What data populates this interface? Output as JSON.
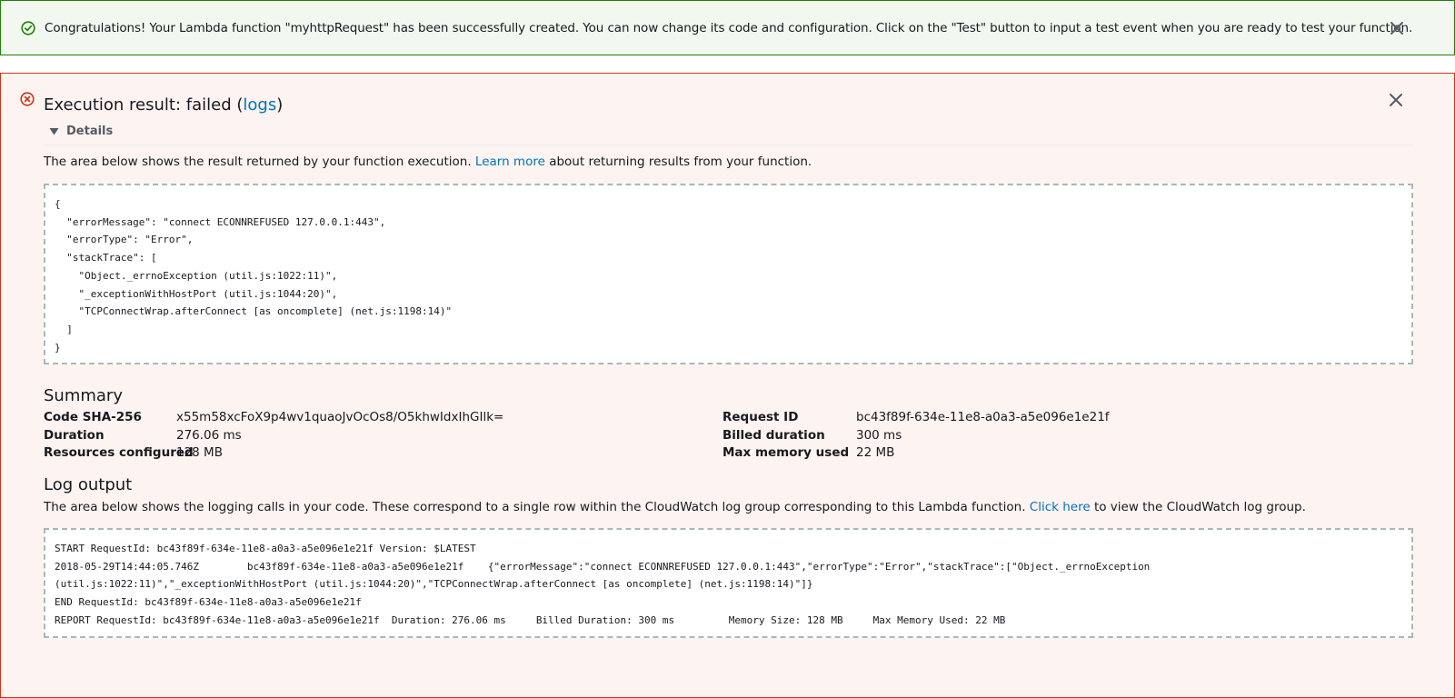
{
  "success_banner": {
    "message": "Congratulations! Your Lambda function \"myhttpRequest\" has been successfully created. You can now change its code and configuration. Click on the \"Test\" button to input a test event when you are ready to test your function."
  },
  "execution": {
    "title_prefix": "Execution result: failed (",
    "logs_link": "logs",
    "title_suffix": ")",
    "details_label": "Details",
    "result_desc_before": "The area below shows the result returned by your function execution. ",
    "result_desc_link": "Learn more",
    "result_desc_after": " about returning results from your function.",
    "result_lines": [
      "{",
      "  \"errorMessage\": \"connect ECONNREFUSED 127.0.0.1:443\",",
      "  \"errorType\": \"Error\",",
      "  \"stackTrace\": [",
      "    \"Object._errnoException (util.js:1022:11)\",",
      "    \"_exceptionWithHostPort (util.js:1044:20)\",",
      "    \"TCPConnectWrap.afterConnect [as oncomplete] (net.js:1198:14)\"",
      "  ]",
      "}"
    ]
  },
  "summary": {
    "title": "Summary",
    "left": [
      {
        "label": "Code SHA-256",
        "value": "x55m58xcFoX9p4wv1quaoJvOcOs8/O5khwIdxIhGIlk="
      },
      {
        "label": "Duration",
        "value": "276.06 ms"
      },
      {
        "label": "Resources configured",
        "value": "128 MB"
      }
    ],
    "right": [
      {
        "label": "Request ID",
        "value": "bc43f89f-634e-11e8-a0a3-a5e096e1e21f"
      },
      {
        "label": "Billed duration",
        "value": "300 ms"
      },
      {
        "label": "Max memory used",
        "value": "22 MB"
      }
    ]
  },
  "log_output": {
    "title": "Log output",
    "desc_before": "The area below shows the logging calls in your code. These correspond to a single row within the CloudWatch log group corresponding to this Lambda function. ",
    "desc_link": "Click here",
    "desc_after": " to view the CloudWatch log group.",
    "lines": [
      "START RequestId: bc43f89f-634e-11e8-a0a3-a5e096e1e21f Version: $LATEST",
      "2018-05-29T14:44:05.746Z\tbc43f89f-634e-11e8-a0a3-a5e096e1e21f\t{\"errorMessage\":\"connect ECONNREFUSED 127.0.0.1:443\",\"errorType\":\"Error\",\"stackTrace\":[\"Object._errnoException",
      "(util.js:1022:11)\",\"_exceptionWithHostPort (util.js:1044:20)\",\"TCPConnectWrap.afterConnect [as oncomplete] (net.js:1198:14)\"]}",
      "END RequestId: bc43f89f-634e-11e8-a0a3-a5e096e1e21f",
      "REPORT RequestId: bc43f89f-634e-11e8-a0a3-a5e096e1e21f\tDuration: 276.06 ms\tBilled Duration: 300 ms \tMemory Size: 128 MB\tMax Memory Used: 22 MB\t"
    ]
  },
  "colors": {
    "success_border": "#1d8102",
    "success_bg": "#f2f8f0",
    "error_border": "#d13212",
    "error_bg": "#fdf3f1",
    "link": "#0073bb"
  },
  "icons": {
    "success": "check-circle-icon",
    "error": "x-circle-icon",
    "close": "close-icon",
    "expand": "caret-down-icon"
  }
}
